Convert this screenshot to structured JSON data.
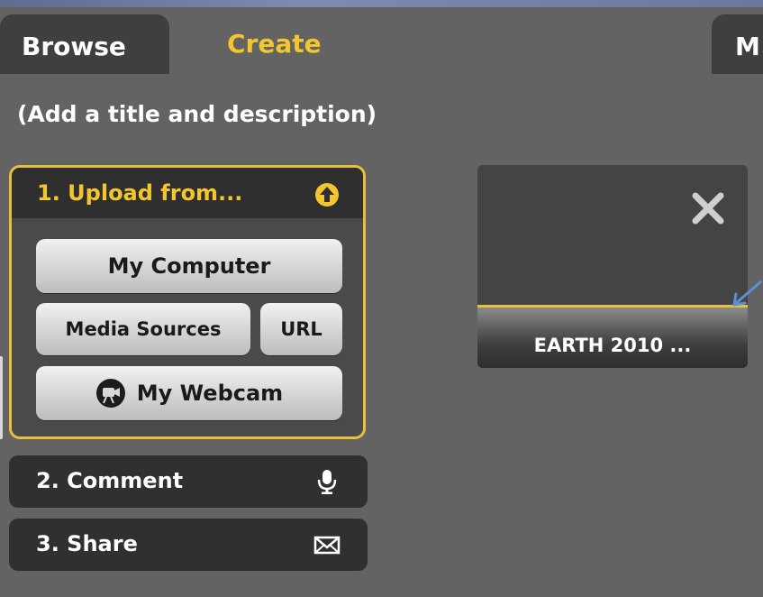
{
  "tabs": {
    "browse": "Browse",
    "create": "Create",
    "more": "M"
  },
  "hint": "(Add a title and description)",
  "upload": {
    "title": "1. Upload from...",
    "my_computer": "My Computer",
    "media_sources": "Media Sources",
    "url": "URL",
    "my_webcam": "My Webcam"
  },
  "steps": {
    "comment": "2. Comment",
    "share": "3. Share"
  },
  "card": {
    "label": "EARTH 2010 ..."
  },
  "colors": {
    "accent": "#f2c62f",
    "panel_border": "#e8bf3a",
    "background": "#636363",
    "arrow": "#5b8fd6"
  },
  "icons": [
    "upload-arrow-icon",
    "webcam-icon",
    "microphone-icon",
    "envelope-icon",
    "close-icon",
    "pointer-arrow-icon"
  ]
}
